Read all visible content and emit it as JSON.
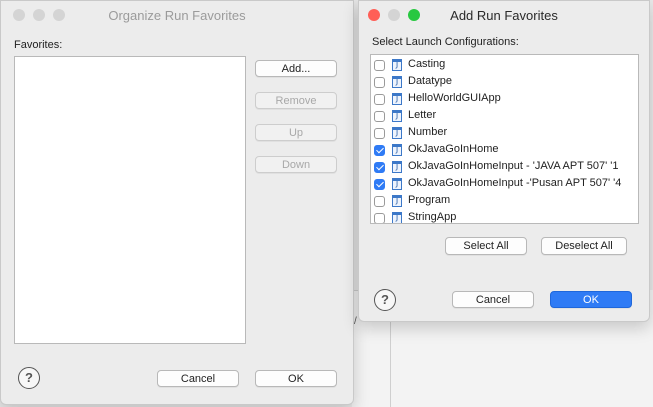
{
  "organize_dialog": {
    "title": "Organize Run Favorites",
    "favorites_label": "Favorites:",
    "buttons": {
      "add": "Add...",
      "remove": "Remove",
      "up": "Up",
      "down": "Down",
      "cancel": "Cancel",
      "ok": "OK"
    },
    "help_glyph": "?"
  },
  "add_dialog": {
    "title": "Add Run Favorites",
    "select_label": "Select Launch Configurations:",
    "configurations": [
      {
        "label": "Casting",
        "checked": false
      },
      {
        "label": "Datatype",
        "checked": false
      },
      {
        "label": "HelloWorldGUIApp",
        "checked": false
      },
      {
        "label": "Letter",
        "checked": false
      },
      {
        "label": "Number",
        "checked": false
      },
      {
        "label": "OkJavaGoInHome",
        "checked": true
      },
      {
        "label": "OkJavaGoInHomeInput - 'JAVA APT 507' '1",
        "checked": true
      },
      {
        "label": "OkJavaGoInHomeInput -'Pusan APT 507' '4",
        "checked": true
      },
      {
        "label": "Program",
        "checked": false
      },
      {
        "label": "StringApp",
        "checked": false
      }
    ],
    "buttons": {
      "select_all": "Select All",
      "deselect_all": "Deselect All",
      "cancel": "Cancel",
      "ok": "OK"
    },
    "help_glyph": "?"
  },
  "background": {
    "mark": "/"
  },
  "colors": {
    "accent": "#2f7bf5",
    "close": "#ff5f57",
    "minimize": "#febc2e",
    "zoom": "#28c840",
    "inactive_light": "#d4d4d4"
  },
  "icons": {
    "config_icon": "java-application-icon",
    "help_icon": "question-icon"
  }
}
